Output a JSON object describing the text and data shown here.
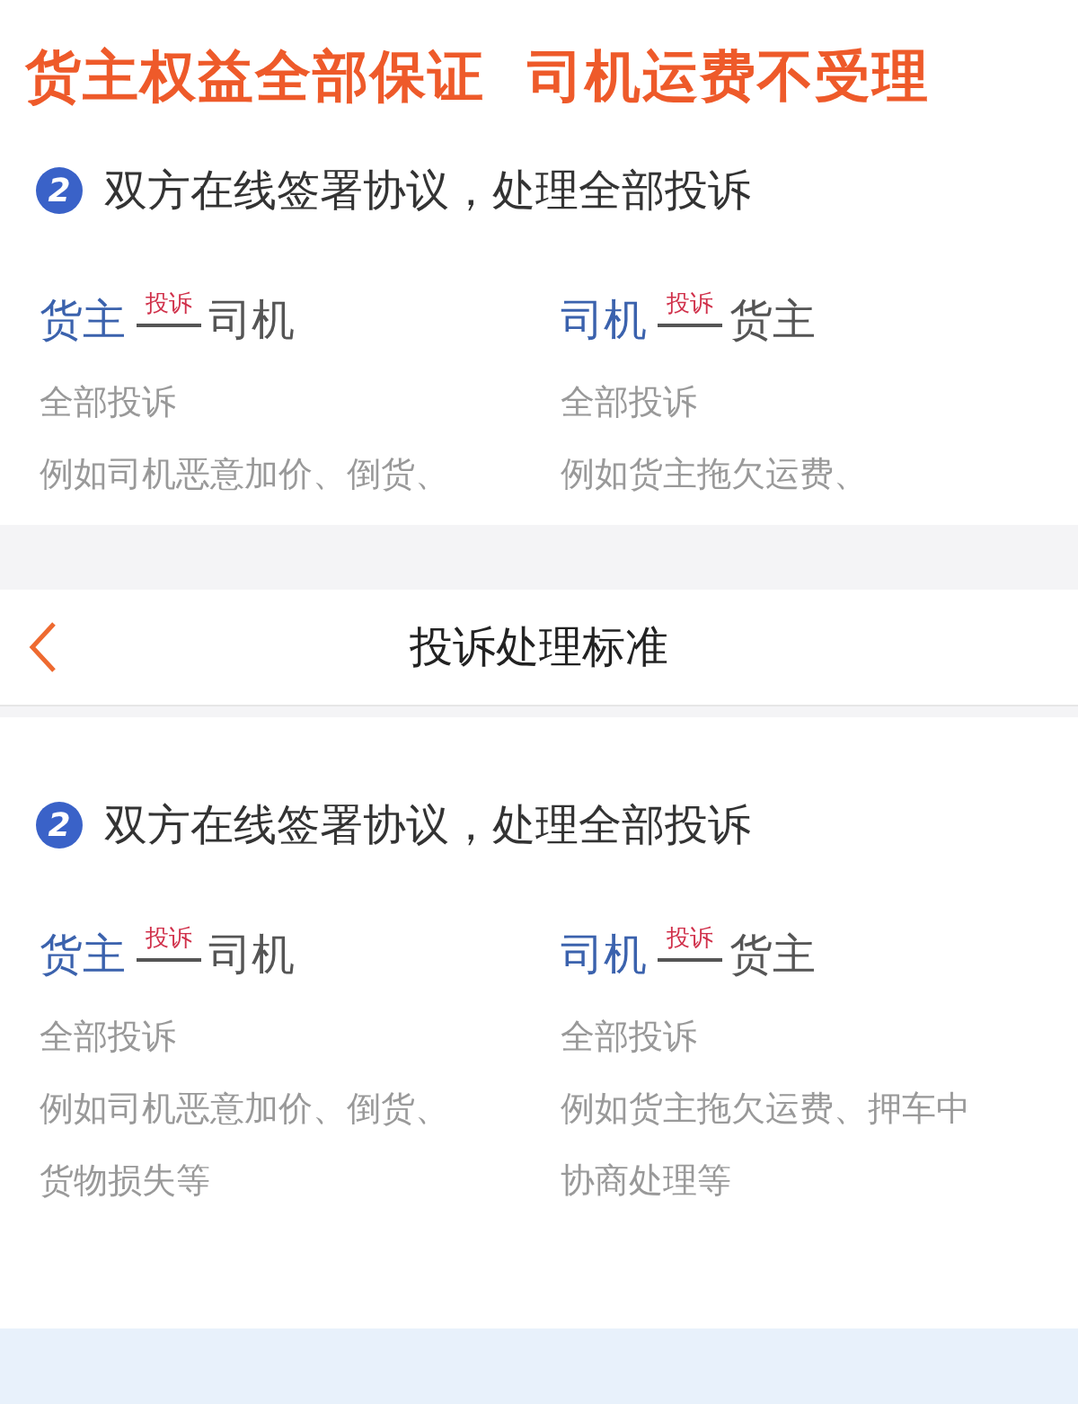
{
  "top_panel": {
    "banner": "货主权益全部保证  司机运费不受理",
    "step": "2",
    "title": "双方在线签署协议，处理全部投诉",
    "columns": [
      {
        "from": "货主",
        "relation": "投诉",
        "to": "司机",
        "lines": [
          "全部投诉",
          "例如司机恶意加价、倒货、"
        ]
      },
      {
        "from": "司机",
        "relation": "投诉",
        "to": "货主",
        "lines": [
          "全部投诉",
          "例如货主拖欠运费、"
        ]
      }
    ]
  },
  "nav_bar": {
    "title": "投诉处理标准"
  },
  "bottom_panel": {
    "step": "2",
    "title": "双方在线签署协议，处理全部投诉",
    "columns": [
      {
        "from": "货主",
        "relation": "投诉",
        "to": "司机",
        "lines": [
          "全部投诉",
          "例如司机恶意加价、倒货、",
          "货物损失等"
        ]
      },
      {
        "from": "司机",
        "relation": "投诉",
        "to": "货主",
        "lines": [
          "全部投诉",
          "例如货主拖欠运费、押车中",
          "协商处理等"
        ]
      }
    ]
  }
}
